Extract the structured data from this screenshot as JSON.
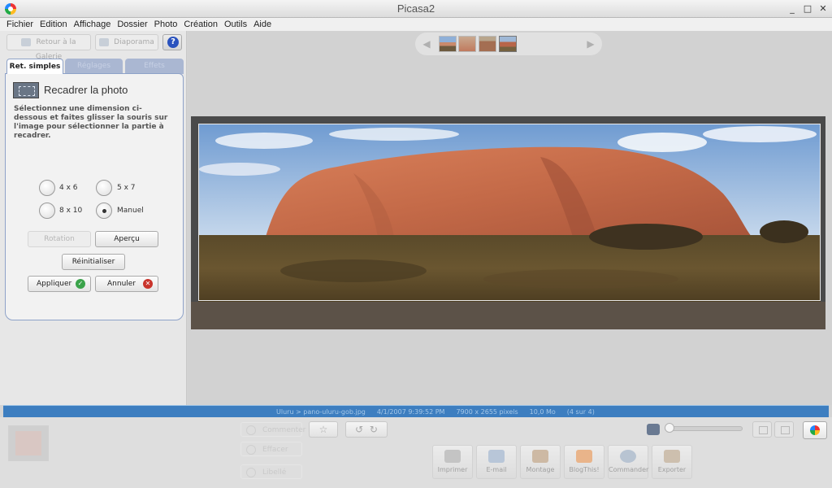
{
  "window": {
    "title": "Picasa2",
    "minimize": "_",
    "maximize": "□",
    "close": "✕"
  },
  "menu": [
    "Fichier",
    "Edition",
    "Affichage",
    "Dossier",
    "Photo",
    "Création",
    "Outils",
    "Aide"
  ],
  "topbar": {
    "back_label": "Retour à la Galerie",
    "slideshow_label": "Diaporama",
    "help_label": "?"
  },
  "tabs": [
    "Ret. simples",
    "Réglages",
    "Effets"
  ],
  "panel": {
    "title": "Recadrer la photo",
    "description": "Sélectionnez une dimension ci-dessous et faites glisser la souris sur l'image pour sélectionner la partie à recadrer.",
    "options": [
      {
        "label": "4 x 6",
        "selected": false
      },
      {
        "label": "5 x 7",
        "selected": false
      },
      {
        "label": "8 x 10",
        "selected": false
      },
      {
        "label": "Manuel",
        "selected": true
      }
    ],
    "buttons": {
      "rotation": "Rotation",
      "preview": "Aperçu",
      "reset": "Réinitialiser",
      "apply": "Appliquer",
      "cancel": "Annuler"
    }
  },
  "filmstrip": {
    "prev": "◀",
    "next": "▶"
  },
  "status": {
    "path": "Uluru > pano-uluru-gob.jpg",
    "date": "4/1/2007 9:39:52 PM",
    "dimensions": "7900 x 2655 pixels",
    "size": "10,0 Mo",
    "position": "(4 sur 4)"
  },
  "bottom": {
    "ghost_labels": [
      "Commenter",
      "Effacer",
      "Libellé"
    ],
    "star": "☆",
    "rotate_left": "↺",
    "rotate_right": "↻",
    "actions": [
      "Imprimer",
      "E-mail",
      "Montage",
      "BlogThis!",
      "Commander",
      "Exporter"
    ]
  },
  "colors": {
    "status_bar": "#3d7ec0",
    "tab_active_border": "#8ea2c8",
    "apply_badge": "#3aa34a",
    "cancel_badge": "#c9332b"
  }
}
